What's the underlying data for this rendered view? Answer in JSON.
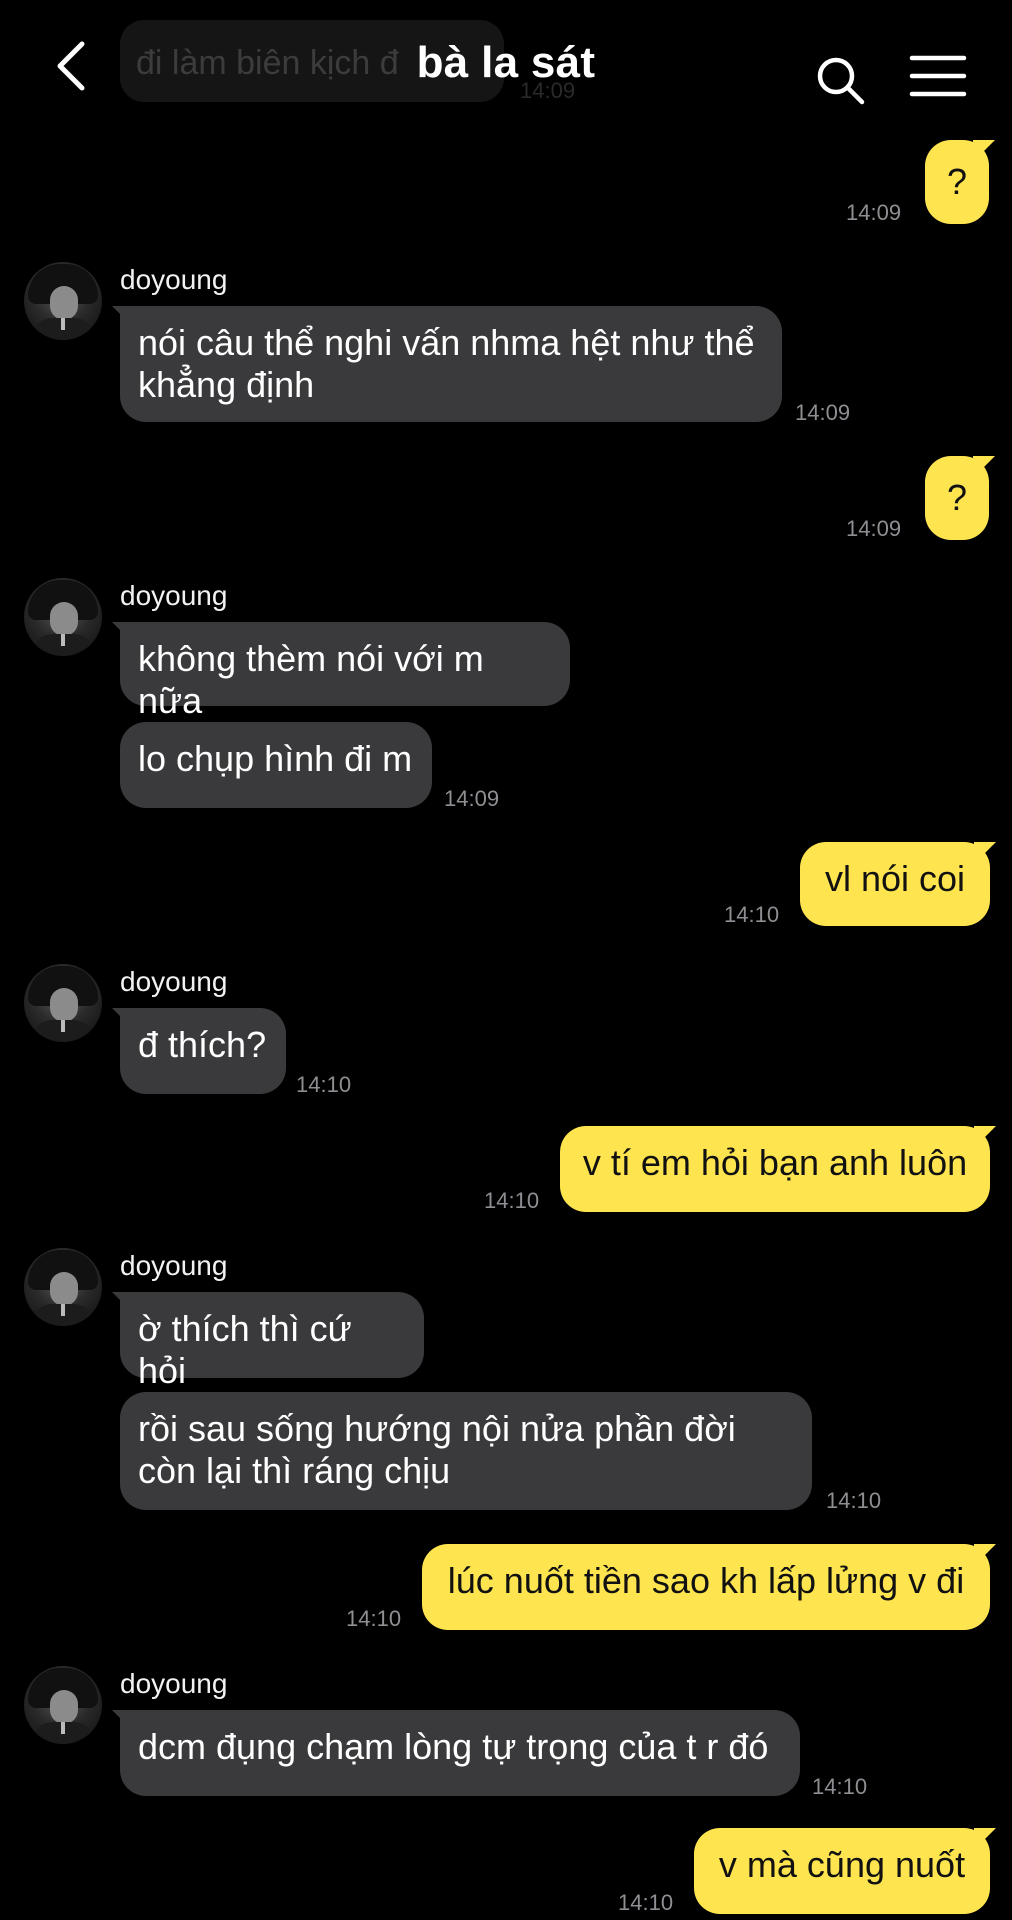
{
  "header": {
    "title": "bà la sát",
    "ghost_text": "đi làm biên kịch đ",
    "ghost_time": "14:09",
    "icons": {
      "back": "back-chevron-icon",
      "search": "search-icon",
      "menu": "menu-icon"
    }
  },
  "colors": {
    "background": "#000000",
    "incoming_bubble": "#3a3a3c",
    "outgoing_bubble": "#fee54f",
    "timestamp": "#8e8e93"
  },
  "messages": [
    {
      "dir": "out",
      "text": "?",
      "time": "14:09"
    },
    {
      "dir": "in",
      "sender": "doyoung",
      "text": "nói câu thể nghi vấn nhma hệt như thể khẳng định",
      "time": "14:09"
    },
    {
      "dir": "out",
      "text": "?",
      "time": "14:09"
    },
    {
      "dir": "in",
      "sender": "doyoung",
      "text": "không thèm nói với m nữa",
      "time": ""
    },
    {
      "dir": "in",
      "sender": "",
      "text": "lo chụp hình đi m",
      "time": "14:09"
    },
    {
      "dir": "out",
      "text": "vl nói coi",
      "time": "14:10"
    },
    {
      "dir": "in",
      "sender": "doyoung",
      "text": "đ thích?",
      "time": "14:10"
    },
    {
      "dir": "out",
      "text": "v tí em hỏi bạn anh luôn",
      "time": "14:10"
    },
    {
      "dir": "in",
      "sender": "doyoung",
      "text": "ờ thích thì cứ hỏi",
      "time": ""
    },
    {
      "dir": "in",
      "sender": "",
      "text": "rồi sau sống hướng nội nửa phần đời còn lại thì ráng chịu",
      "time": "14:10"
    },
    {
      "dir": "out",
      "text": "lúc nuốt tiền sao kh lấp lửng v đi",
      "time": "14:10"
    },
    {
      "dir": "in",
      "sender": "doyoung",
      "text": "dcm đụng chạm lòng tự trọng của t r đó",
      "time": "14:10"
    },
    {
      "dir": "out",
      "text": "v mà cũng nuốt",
      "time": "14:10"
    }
  ]
}
